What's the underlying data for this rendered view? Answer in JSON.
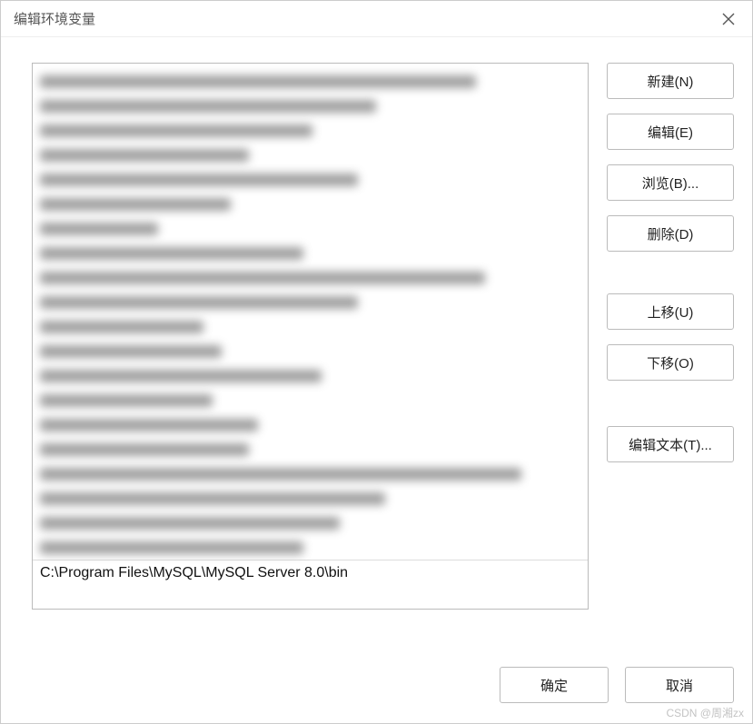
{
  "dialog": {
    "title": "编辑环境变量"
  },
  "list": {
    "blurred_count": 20,
    "blur_widths": [
      480,
      370,
      300,
      230,
      350,
      210,
      130,
      290,
      490,
      350,
      180,
      200,
      310,
      190,
      240,
      230,
      530,
      380,
      330,
      290
    ],
    "last_item": "C:\\Program Files\\MySQL\\MySQL Server 8.0\\bin"
  },
  "buttons": {
    "new_": "新建(N)",
    "edit": "编辑(E)",
    "browse": "浏览(B)...",
    "delete_": "删除(D)",
    "move_up": "上移(U)",
    "move_down": "下移(O)",
    "edit_text": "编辑文本(T)...",
    "ok": "确定",
    "cancel": "取消"
  },
  "watermark": "CSDN @周湘zx"
}
